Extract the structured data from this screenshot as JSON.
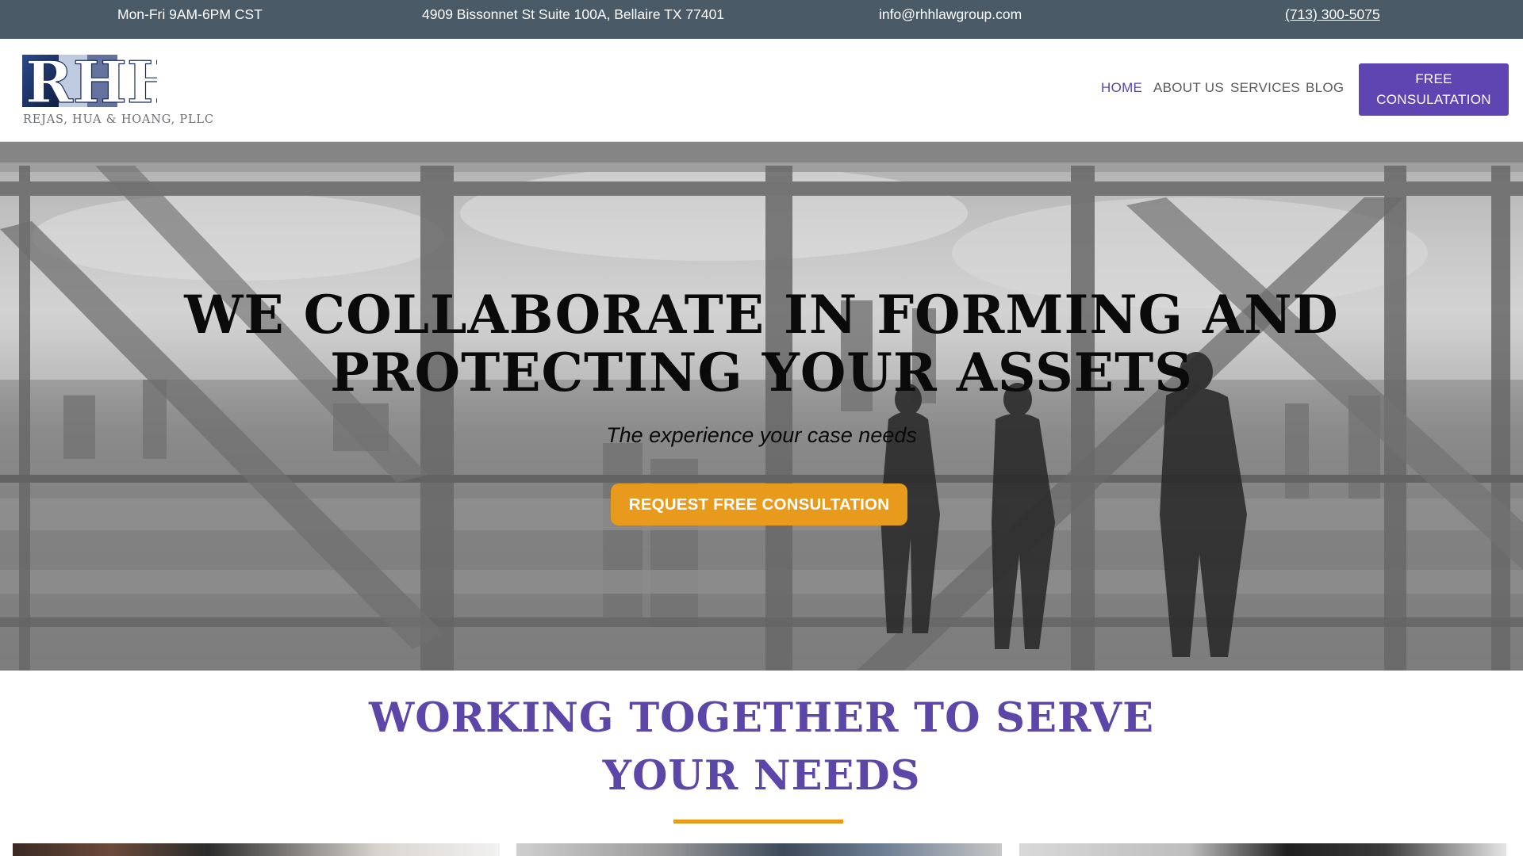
{
  "topbar": {
    "hours": "Mon-Fri 9AM-6PM CST",
    "address": "4909 Bissonnet St Suite 100A, Bellaire TX 77401",
    "email": "info@rhhlawgroup.com",
    "phone": "(713) 300-5075"
  },
  "header": {
    "logo": {
      "monogram": "RHH",
      "firm_name": "REJAS, HUA & HOANG, PLLC"
    },
    "nav": [
      {
        "label": "HOME",
        "active": true
      },
      {
        "label": "ABOUT US",
        "active": false
      },
      {
        "label": "SERVICES",
        "active": false
      },
      {
        "label": "BLOG",
        "active": false
      }
    ],
    "cta_label": "FREE CONSULATATION"
  },
  "hero": {
    "title_line1": "WE COLLABORATE IN FORMING AND",
    "title_line2": "PROTECTING YOUR ASSETS",
    "subtitle": "The experience your case needs",
    "button_label": "REQUEST FREE CONSULTATION"
  },
  "section": {
    "title_line1": "WORKING TOGETHER TO SERVE",
    "title_line2": "YOUR NEEDS"
  },
  "colors": {
    "topbar_bg": "#4a5a66",
    "brand_purple": "#5e45b2",
    "accent_orange": "#e79a1b",
    "nav_active": "#5b47a6"
  }
}
